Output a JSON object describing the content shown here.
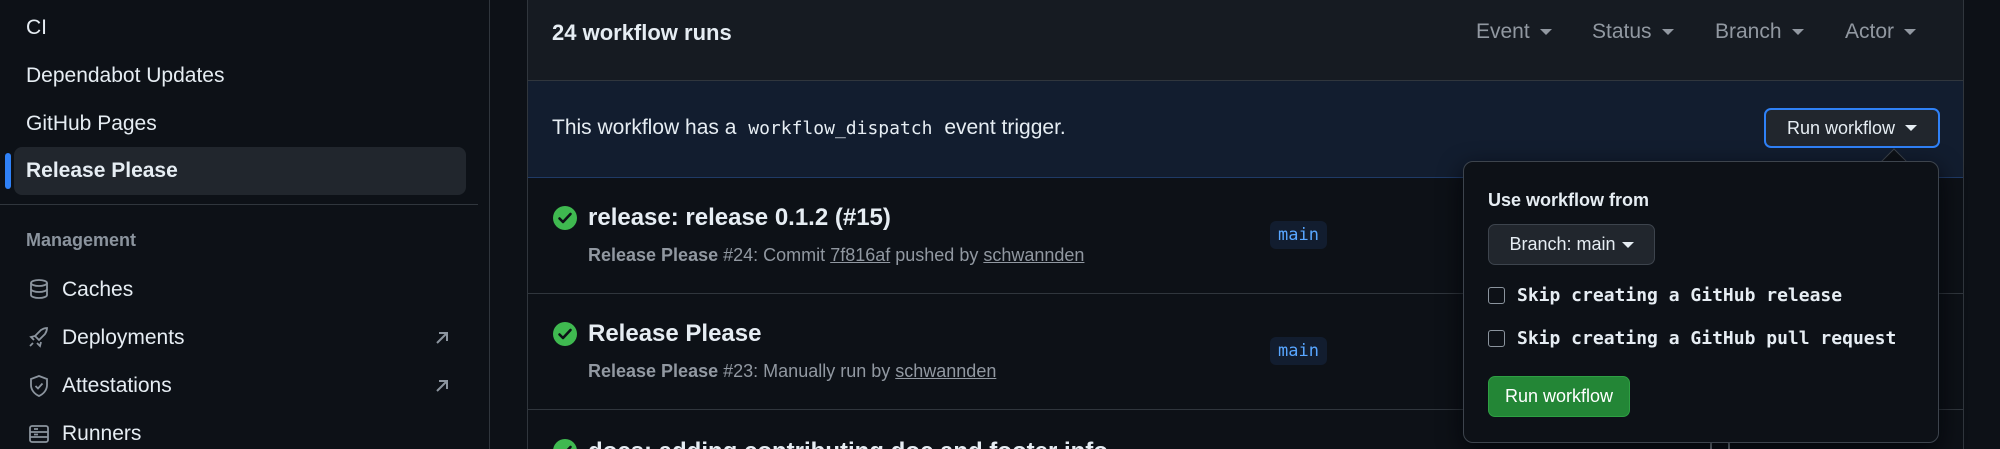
{
  "sidebar": {
    "items": [
      {
        "label": "CI"
      },
      {
        "label": "Dependabot Updates"
      },
      {
        "label": "GitHub Pages"
      },
      {
        "label": "Release Please",
        "active": true
      }
    ],
    "management_heading": "Management",
    "management_items": [
      {
        "label": "Caches",
        "icon": "database-icon"
      },
      {
        "label": "Deployments",
        "icon": "rocket-icon",
        "external": true
      },
      {
        "label": "Attestations",
        "icon": "shield-check-icon",
        "external": true
      },
      {
        "label": "Runners",
        "icon": "server-icon"
      }
    ]
  },
  "header": {
    "runs_count": "24 workflow runs",
    "filters": [
      "Event",
      "Status",
      "Branch",
      "Actor"
    ]
  },
  "dispatch": {
    "text_before": "This workflow has a",
    "code": "workflow_dispatch",
    "text_after": "event trigger.",
    "run_button": "Run workflow"
  },
  "runs": [
    {
      "title": "release: release 0.1.2 (#15)",
      "workflow": "Release Please",
      "number": "#24",
      "meta_mid": ": Commit",
      "commit": "7f816af",
      "meta_by": "pushed by",
      "user": "schwannden",
      "branch": "main",
      "status": "success"
    },
    {
      "title": "Release Please",
      "workflow": "Release Please",
      "number": "#23",
      "meta_mid": ": Manually run by",
      "user": "schwannden",
      "branch": "main",
      "status": "success"
    },
    {
      "title": "docs: adding contributing doc and footer info",
      "status": "success"
    }
  ],
  "popover": {
    "heading": "Use workflow from",
    "branch_select": "Branch: main",
    "checkbox_1": "Skip creating a GitHub release",
    "checkbox_2": "Skip creating a GitHub pull request",
    "run_button": "Run workflow"
  },
  "colors": {
    "accent_blue": "#2f81f7",
    "success_green": "#3fb950",
    "button_green": "#238636"
  }
}
